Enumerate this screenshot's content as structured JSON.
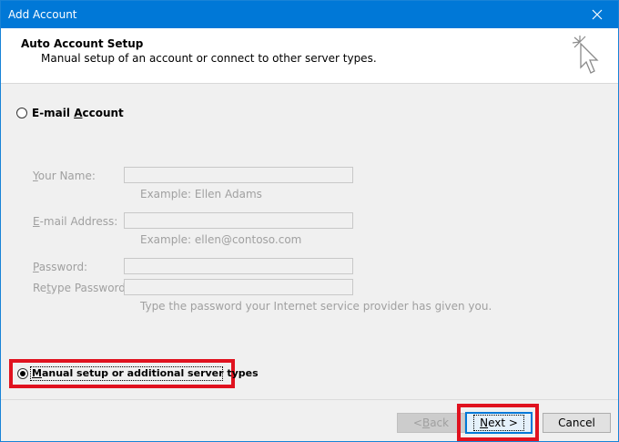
{
  "window": {
    "title": "Add Account"
  },
  "header": {
    "title": "Auto Account Setup",
    "subtitle": "Manual setup of an account or connect to other server types."
  },
  "email_option": {
    "pre": "E-mail ",
    "accel": "A",
    "post": "ccount",
    "selected": false
  },
  "fields": {
    "name": {
      "label_accel": "Y",
      "label_rest": "our Name:",
      "value": "",
      "example": "Example: Ellen Adams"
    },
    "email": {
      "label_accel": "E",
      "label_rest": "-mail Address:",
      "value": "",
      "example": "Example: ellen@contoso.com"
    },
    "password": {
      "label_accel": "P",
      "label_rest": "assword:",
      "value": ""
    },
    "retype": {
      "label_pre": "Re",
      "label_accel": "t",
      "label_rest": "ype Password:",
      "value": "",
      "hint": "Type the password your Internet service provider has given you."
    }
  },
  "manual_option": {
    "accel": "M",
    "rest": "anual setup or additional server types",
    "selected": true
  },
  "buttons": {
    "back": {
      "accel_pre": "< ",
      "accel": "B",
      "rest": "ack"
    },
    "next": {
      "accel": "N",
      "rest": "ext >"
    },
    "cancel": {
      "label": "Cancel"
    }
  },
  "colors": {
    "titlebar": "#0078d7",
    "highlight": "#e0121f"
  }
}
